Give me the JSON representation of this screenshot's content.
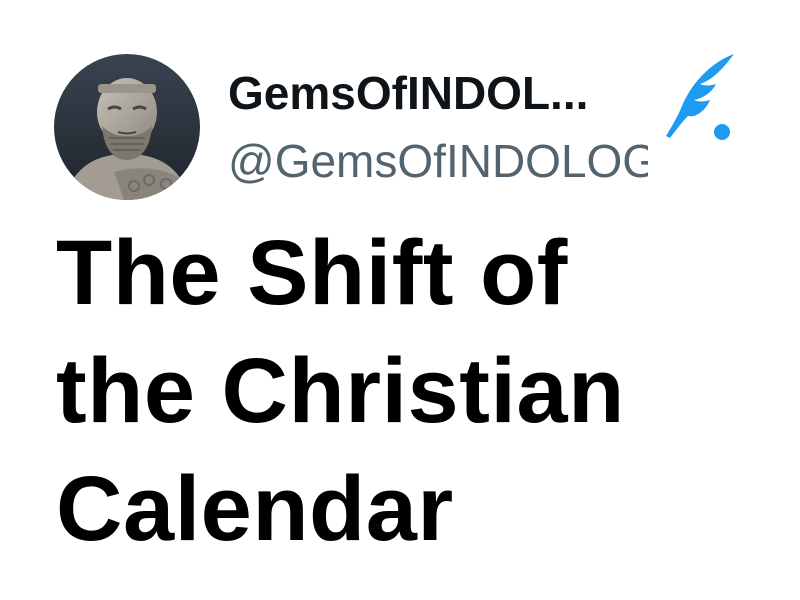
{
  "author": {
    "display_name": "GemsOfINDOL...",
    "handle": "@GemsOfINDOLOGY",
    "avatar_icon": "bearded-statue-avatar"
  },
  "app": {
    "logo_icon": "feather-quill-icon",
    "accent_color": "#1d9bf0"
  },
  "content": {
    "title_lines": [
      "The Shift of",
      "the Christian",
      "Calendar"
    ]
  }
}
